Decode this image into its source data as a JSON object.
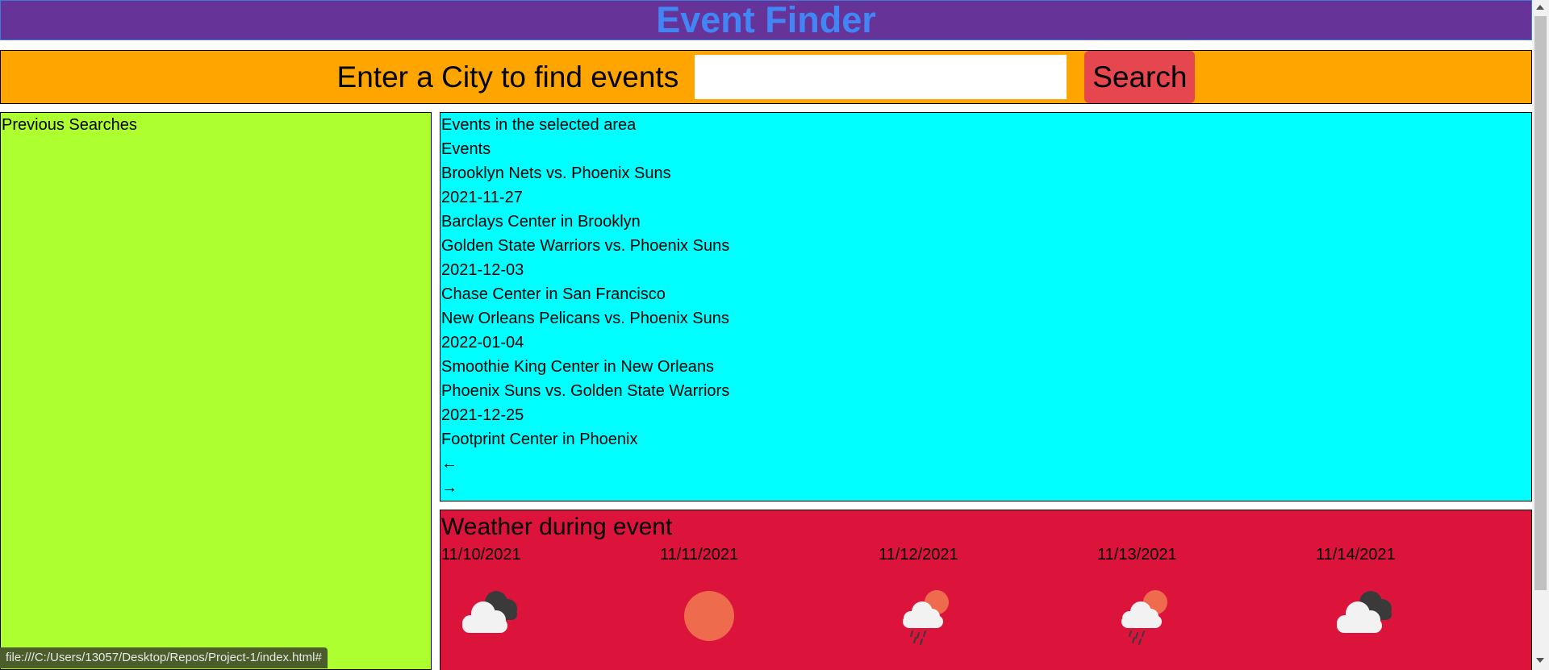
{
  "header": {
    "title": "Event Finder"
  },
  "search": {
    "label": "Enter a City to find events",
    "input_value": "",
    "button_label": "Search"
  },
  "previous_searches": {
    "title": "Previous Searches"
  },
  "events_panel": {
    "title": "Events in the selected area",
    "subtitle": "Events",
    "events": [
      {
        "name": "Brooklyn Nets vs. Phoenix Suns",
        "date": "2021-11-27",
        "venue": "Barclays Center in Brooklyn"
      },
      {
        "name": "Golden State Warriors vs. Phoenix Suns",
        "date": "2021-12-03",
        "venue": "Chase Center in San Francisco"
      },
      {
        "name": "New Orleans Pelicans vs. Phoenix Suns",
        "date": "2022-01-04",
        "venue": "Smoothie King Center in New Orleans"
      },
      {
        "name": "Phoenix Suns vs. Golden State Warriors",
        "date": "2021-12-25",
        "venue": "Footprint Center in Phoenix"
      }
    ],
    "prev_arrow": "←",
    "next_arrow": "→"
  },
  "weather": {
    "title": "Weather during event",
    "days": [
      {
        "date": "11/10/2021",
        "icon": "broken-clouds-icon"
      },
      {
        "date": "11/11/2021",
        "icon": "clear-sky-icon"
      },
      {
        "date": "11/12/2021",
        "icon": "rain-icon"
      },
      {
        "date": "11/13/2021",
        "icon": "rain-icon"
      },
      {
        "date": "11/14/2021",
        "icon": "broken-clouds-icon"
      }
    ]
  },
  "status_bar": {
    "url": "file:///C:/Users/13057/Desktop/Repos/Project-1/index.html#"
  },
  "colors": {
    "header_bg": "#663399",
    "title": "#4285f4",
    "search_bar_bg": "#ffa500",
    "search_button": "#e6474f",
    "previous_panel_bg": "#adff2f",
    "events_panel_bg": "#00ffff",
    "weather_panel_bg": "#dc143c"
  }
}
